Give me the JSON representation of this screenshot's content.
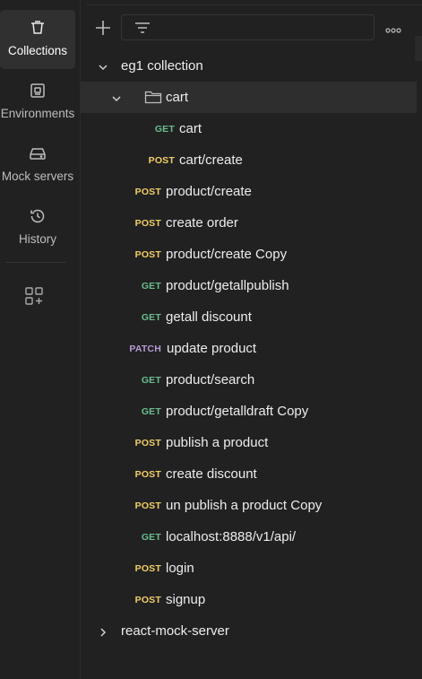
{
  "sidebar": {
    "items": [
      {
        "label": "Collections",
        "icon": "trash-bin-icon",
        "active": true
      },
      {
        "label": "Environments",
        "icon": "environment-icon",
        "active": false
      },
      {
        "label": "Mock servers",
        "icon": "server-icon",
        "active": false
      },
      {
        "label": "History",
        "icon": "history-icon",
        "active": false
      }
    ],
    "extra_icon": "add-workbench-icon"
  },
  "toolbar": {
    "add_icon": "plus-icon",
    "filter_icon": "filter-icon",
    "more_icon": "more-horizontal-icon"
  },
  "tree": {
    "collection": {
      "name": "eg1 collection",
      "expanded": true
    },
    "folder": {
      "name": "cart",
      "expanded": true
    },
    "folder_requests": [
      {
        "method": "GET",
        "name": "cart"
      },
      {
        "method": "POST",
        "name": "cart/create"
      }
    ],
    "requests": [
      {
        "method": "POST",
        "name": "product/create"
      },
      {
        "method": "POST",
        "name": "create order"
      },
      {
        "method": "POST",
        "name": "product/create Copy"
      },
      {
        "method": "GET",
        "name": "product/getallpublish"
      },
      {
        "method": "GET",
        "name": "getall discount"
      },
      {
        "method": "PATCH",
        "name": "update product"
      },
      {
        "method": "GET",
        "name": "product/search"
      },
      {
        "method": "GET",
        "name": "product/getalldraft Copy"
      },
      {
        "method": "POST",
        "name": "publish a product"
      },
      {
        "method": "POST",
        "name": "create discount"
      },
      {
        "method": "POST",
        "name": "un publish a product Copy"
      },
      {
        "method": "GET",
        "name": "localhost:8888/v1/api/"
      },
      {
        "method": "POST",
        "name": "login"
      },
      {
        "method": "POST",
        "name": "signup"
      }
    ],
    "other_collection": {
      "name": "react-mock-server",
      "expanded": false
    }
  },
  "colors": {
    "background": "#212121",
    "get": "#6bbd8e",
    "post": "#f2cf66",
    "patch": "#b89ad6",
    "text": "#ededed"
  }
}
